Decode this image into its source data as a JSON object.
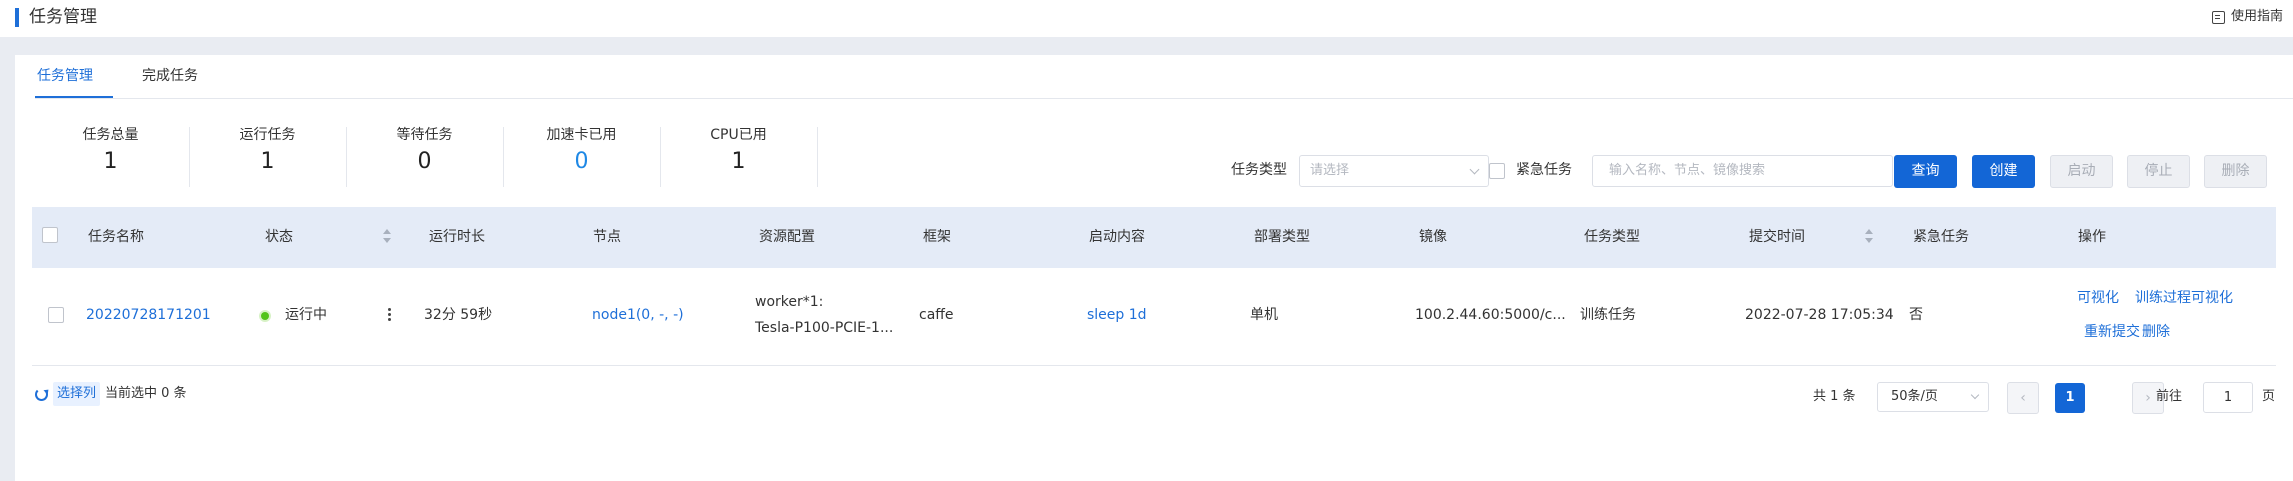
{
  "header": {
    "title": "任务管理",
    "guide_label": "使用指南"
  },
  "tabs": [
    {
      "label": "任务管理",
      "active": true
    },
    {
      "label": "完成任务",
      "active": false
    }
  ],
  "stats": [
    {
      "label": "任务总量",
      "value": "1"
    },
    {
      "label": "运行任务",
      "value": "1"
    },
    {
      "label": "等待任务",
      "value": "0"
    },
    {
      "label": "加速卡已用",
      "value": "0"
    },
    {
      "label": "CPU已用",
      "value": "1"
    }
  ],
  "filters": {
    "task_type_label": "任务类型",
    "task_type_placeholder": "请选择",
    "urgent_label": "紧急任务",
    "urgent_checked": false,
    "search_placeholder": "输入名称、节点、镜像搜索"
  },
  "buttons": {
    "query": "查询",
    "create": "创建",
    "start": "启动",
    "stop": "停止",
    "delete": "删除"
  },
  "table": {
    "columns": [
      "任务名称",
      "状态",
      "运行时长",
      "节点",
      "资源配置",
      "框架",
      "启动内容",
      "部署类型",
      "镜像",
      "任务类型",
      "提交时间",
      "紧急任务",
      "操作"
    ],
    "rows": [
      {
        "name": "20220728171201",
        "status": "运行中",
        "duration": "32分 59秒",
        "node": "node1(0, -, -)",
        "resource_line1": "worker*1:",
        "resource_line2": "Tesla-P100-PCIE-1...",
        "framework": "caffe",
        "start_content": "sleep 1d",
        "deploy_type": "单机",
        "image": "100.2.44.60:5000/c...",
        "task_type": "训练任务",
        "submit_time": "2022-07-28 17:05:34",
        "urgent": "否",
        "actions": [
          "可视化",
          "训练过程可视化",
          "重新提交",
          "删除"
        ]
      }
    ]
  },
  "footer": {
    "select_columns": "选择列",
    "selected_count": "当前选中 0 条",
    "total": "共 1 条",
    "page_size": "50条/页",
    "prev": "‹",
    "current_page": "1",
    "next": "›",
    "goto_label": "前往",
    "goto_value": "1",
    "page_suffix": "页"
  },
  "colors": {
    "primary": "#1366d6",
    "link": "#1e6fd8",
    "running": "#52c41a",
    "table_header": "#e4ebf7",
    "background": "#e9ecf2"
  }
}
